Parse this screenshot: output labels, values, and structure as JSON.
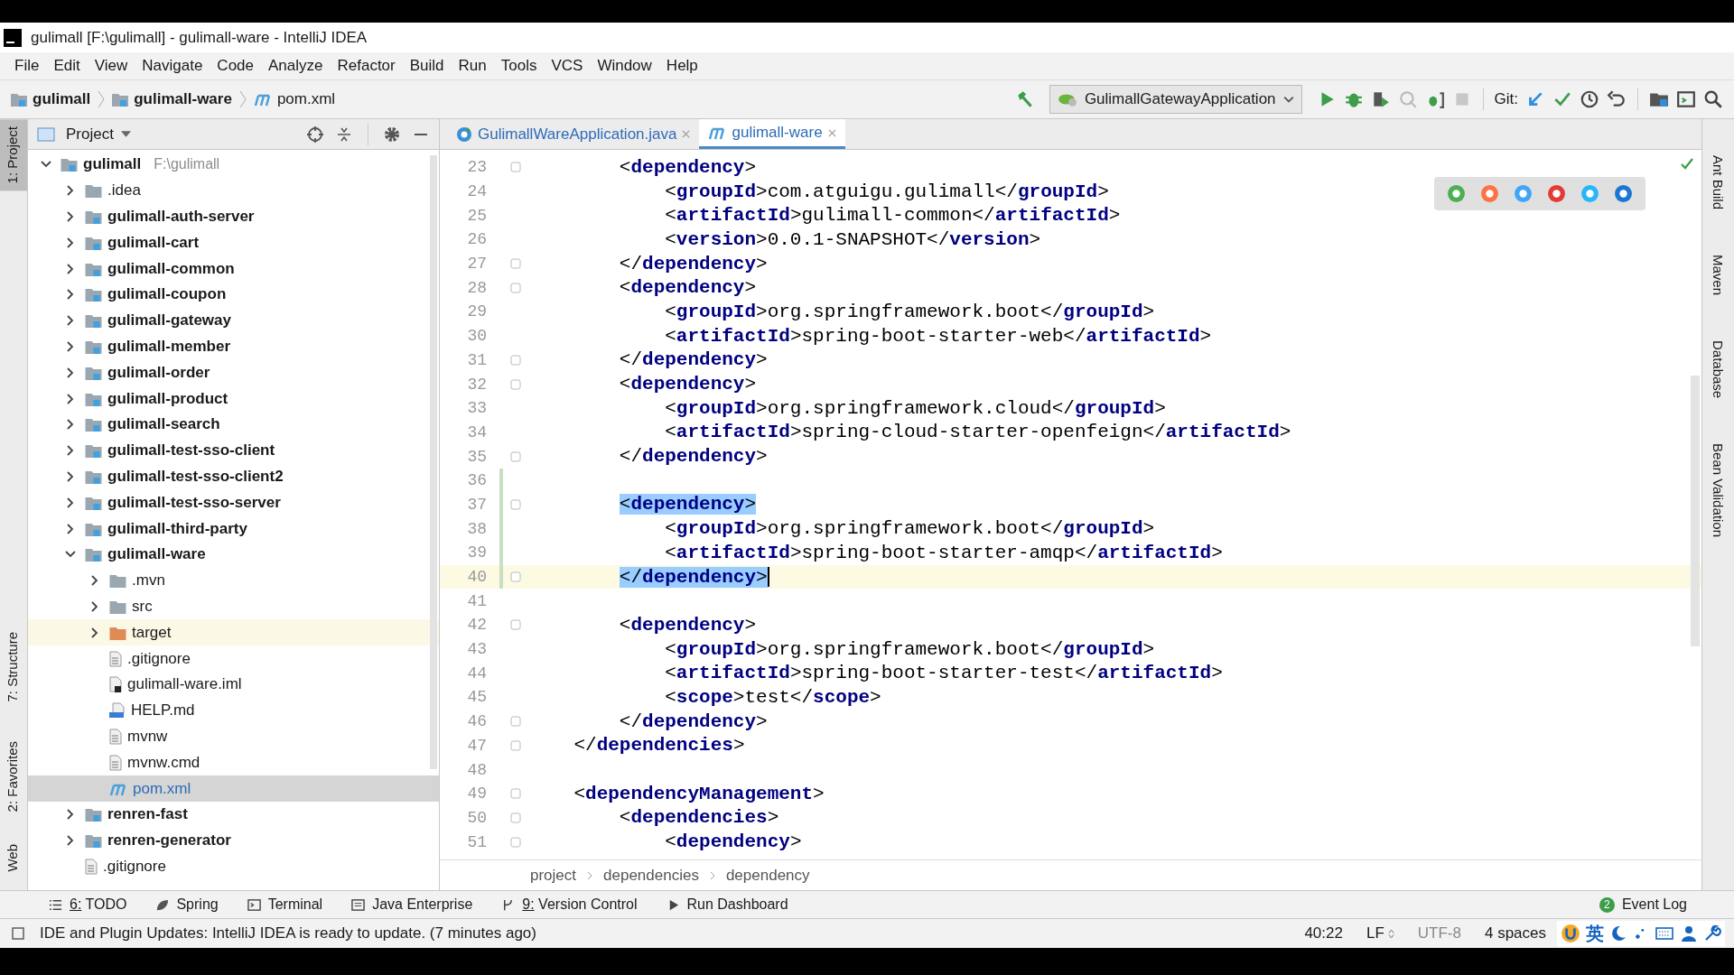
{
  "window": {
    "title": "gulimall [F:\\gulimall] - gulimall-ware - IntelliJ IDEA"
  },
  "menu": [
    "File",
    "Edit",
    "View",
    "Navigate",
    "Code",
    "Analyze",
    "Refactor",
    "Build",
    "Run",
    "Tools",
    "VCS",
    "Window",
    "Help"
  ],
  "nav_path": [
    {
      "label": "gulimall",
      "kind": "module"
    },
    {
      "label": "gulimall-ware",
      "kind": "module"
    },
    {
      "label": "pom.xml",
      "kind": "maven"
    }
  ],
  "toolbar": {
    "run_config": "GulimallGatewayApplication",
    "git_label": "Git:"
  },
  "left_strip": [
    {
      "label": "1: Project",
      "selected": true
    },
    {
      "label": "7: Structure",
      "selected": false
    },
    {
      "label": "2: Favorites",
      "selected": false
    },
    {
      "label": "Web",
      "selected": false
    }
  ],
  "right_strip": [
    "Ant Build",
    "Maven",
    "Database",
    "Bean Validation"
  ],
  "project_panel": {
    "title": "Project",
    "tree": [
      {
        "label": "gulimall",
        "path": "F:\\gulimall",
        "kind": "module",
        "expanded": true,
        "selected": false,
        "children": [
          {
            "label": ".idea",
            "kind": "folder",
            "expanded": false,
            "selected": false
          },
          {
            "label": "gulimall-auth-server",
            "kind": "module",
            "expanded": false,
            "selected": false
          },
          {
            "label": "gulimall-cart",
            "kind": "module",
            "expanded": false,
            "selected": false
          },
          {
            "label": "gulimall-common",
            "kind": "module",
            "expanded": false,
            "selected": false
          },
          {
            "label": "gulimall-coupon",
            "kind": "module",
            "expanded": false,
            "selected": false
          },
          {
            "label": "gulimall-gateway",
            "kind": "module",
            "expanded": false,
            "selected": false
          },
          {
            "label": "gulimall-member",
            "kind": "module",
            "expanded": false,
            "selected": false
          },
          {
            "label": "gulimall-order",
            "kind": "module",
            "expanded": false,
            "selected": false
          },
          {
            "label": "gulimall-product",
            "kind": "module",
            "expanded": false,
            "selected": false
          },
          {
            "label": "gulimall-search",
            "kind": "module",
            "expanded": false,
            "selected": false
          },
          {
            "label": "gulimall-test-sso-client",
            "kind": "module",
            "expanded": false,
            "selected": false
          },
          {
            "label": "gulimall-test-sso-client2",
            "kind": "module",
            "expanded": false,
            "selected": false
          },
          {
            "label": "gulimall-test-sso-server",
            "kind": "module",
            "expanded": false,
            "selected": false
          },
          {
            "label": "gulimall-third-party",
            "kind": "module",
            "expanded": false,
            "selected": false
          },
          {
            "label": "gulimall-ware",
            "kind": "module",
            "expanded": true,
            "selected": false,
            "children": [
              {
                "label": ".mvn",
                "kind": "folder",
                "expanded": false,
                "selected": false
              },
              {
                "label": "src",
                "kind": "folder",
                "expanded": false,
                "selected": false
              },
              {
                "label": "target",
                "kind": "excluded",
                "expanded": false,
                "selected": false
              },
              {
                "label": ".gitignore",
                "kind": "file",
                "selected": false
              },
              {
                "label": "gulimall-ware.iml",
                "kind": "iml",
                "selected": false
              },
              {
                "label": "HELP.md",
                "kind": "md",
                "selected": false
              },
              {
                "label": "mvnw",
                "kind": "file",
                "selected": false
              },
              {
                "label": "mvnw.cmd",
                "kind": "file",
                "selected": false
              },
              {
                "label": "pom.xml",
                "kind": "maven",
                "selected": true
              }
            ]
          },
          {
            "label": "renren-fast",
            "kind": "module",
            "expanded": false,
            "selected": false
          },
          {
            "label": "renren-generator",
            "kind": "module",
            "expanded": false,
            "selected": false
          },
          {
            "label": ".gitignore",
            "kind": "file",
            "selected": false
          }
        ]
      }
    ]
  },
  "editor_tabs": [
    {
      "label": "GulimallWareApplication.java",
      "kind": "java",
      "selected": false
    },
    {
      "label": "gulimall-ware",
      "kind": "maven",
      "selected": true
    }
  ],
  "code_lines": [
    {
      "number": "23",
      "code": "        <**dependency**>",
      "fold": true,
      "changed": false,
      "current": false,
      "matched": false
    },
    {
      "number": "24",
      "code": "            <**groupId**>com.atguigu.gulimall</**groupId**>",
      "fold": false,
      "changed": false,
      "current": false,
      "matched": false
    },
    {
      "number": "25",
      "code": "            <**artifactId**>gulimall-common</**artifactId**>",
      "fold": false,
      "changed": false,
      "current": false,
      "matched": false
    },
    {
      "number": "26",
      "code": "            <**version**>0.0.1-SNAPSHOT</**version**>",
      "fold": false,
      "changed": false,
      "current": false,
      "matched": false
    },
    {
      "number": "27",
      "code": "        </**dependency**>",
      "fold": true,
      "changed": false,
      "current": false,
      "matched": false
    },
    {
      "number": "28",
      "code": "        <**dependency**>",
      "fold": true,
      "changed": false,
      "current": false,
      "matched": false
    },
    {
      "number": "29",
      "code": "            <**groupId**>org.springframework.boot</**groupId**>",
      "fold": false,
      "changed": false,
      "current": false,
      "matched": false
    },
    {
      "number": "30",
      "code": "            <**artifactId**>spring-boot-starter-web</**artifactId**>",
      "fold": false,
      "changed": false,
      "current": false,
      "matched": false
    },
    {
      "number": "31",
      "code": "        </**dependency**>",
      "fold": true,
      "changed": false,
      "current": false,
      "matched": false
    },
    {
      "number": "32",
      "code": "        <**dependency**>",
      "fold": true,
      "changed": false,
      "current": false,
      "matched": false
    },
    {
      "number": "33",
      "code": "            <**groupId**>org.springframework.cloud</**groupId**>",
      "fold": false,
      "changed": false,
      "current": false,
      "matched": false
    },
    {
      "number": "34",
      "code": "            <**artifactId**>spring-cloud-starter-openfeign</**artifactId**>",
      "fold": false,
      "changed": false,
      "current": false,
      "matched": false
    },
    {
      "number": "35",
      "code": "        </**dependency**>",
      "fold": true,
      "changed": false,
      "current": false,
      "matched": false
    },
    {
      "number": "36",
      "fold": false,
      "changed": true,
      "current": false
    },
    {
      "number": "37",
      "code": "        <**dependency**>",
      "fold": true,
      "changed": true,
      "current": false,
      "matched": true
    },
    {
      "number": "38",
      "code": "            <**groupId**>org.springframework.boot</**groupId**>",
      "fold": false,
      "changed": true,
      "current": false,
      "matched": false
    },
    {
      "number": "39",
      "code": "            <**artifactId**>spring-boot-starter-amqp</**artifactId**>",
      "fold": false,
      "changed": true,
      "current": false,
      "matched": false
    },
    {
      "number": "40",
      "code": "        </**dependency**>",
      "fold": true,
      "changed": true,
      "current": true,
      "matched": true
    },
    {
      "number": "41",
      "fold": false,
      "changed": false,
      "current": false
    },
    {
      "number": "42",
      "code": "        <**dependency**>",
      "fold": true,
      "changed": false,
      "current": false,
      "matched": false
    },
    {
      "number": "43",
      "code": "            <**groupId**>org.springframework.boot</**groupId**>",
      "fold": false,
      "changed": false,
      "current": false,
      "matched": false
    },
    {
      "number": "44",
      "code": "            <**artifactId**>spring-boot-starter-test</**artifactId**>",
      "fold": false,
      "changed": false,
      "current": false,
      "matched": false
    },
    {
      "number": "45",
      "code": "            <**scope**>test</**scope**>",
      "fold": false,
      "changed": false,
      "current": false,
      "matched": false
    },
    {
      "number": "46",
      "code": "        </**dependency**>",
      "fold": true,
      "changed": false,
      "current": false,
      "matched": false
    },
    {
      "number": "47",
      "code": "    </**dependencies**>",
      "fold": true,
      "changed": false,
      "current": false,
      "matched": false
    },
    {
      "number": "48",
      "fold": false,
      "changed": false,
      "current": false
    },
    {
      "number": "49",
      "code": "    <**dependencyManagement**>",
      "fold": true,
      "changed": false,
      "current": false,
      "matched": false
    },
    {
      "number": "50",
      "code": "        <**dependencies**>",
      "fold": true,
      "changed": false,
      "current": false,
      "matched": false
    },
    {
      "number": "51",
      "code": "            <**dependency**>",
      "fold": true,
      "changed": false,
      "current": false,
      "matched": false
    }
  ],
  "breadcrumb": [
    "project",
    "dependencies",
    "dependency"
  ],
  "tool_buttons": [
    {
      "label": "TODO",
      "mnemonic": "6:",
      "kind": "todo"
    },
    {
      "label": "Spring",
      "kind": "spring"
    },
    {
      "label": "Terminal",
      "kind": "terminal"
    },
    {
      "label": "Java Enterprise",
      "kind": "javaee"
    },
    {
      "label": "Version Control",
      "mnemonic": "9:",
      "kind": "vcs"
    },
    {
      "label": "Run Dashboard",
      "kind": "run"
    }
  ],
  "event_log": {
    "label": "Event Log",
    "count": "2"
  },
  "status_bar": {
    "message": "IDE and Plugin Updates: IntelliJ IDEA is ready to update. (7 minutes ago)",
    "position": "40:22",
    "line_sep": "LF",
    "encoding": "UTF-8",
    "indent": "4 spaces",
    "ime": "英"
  }
}
